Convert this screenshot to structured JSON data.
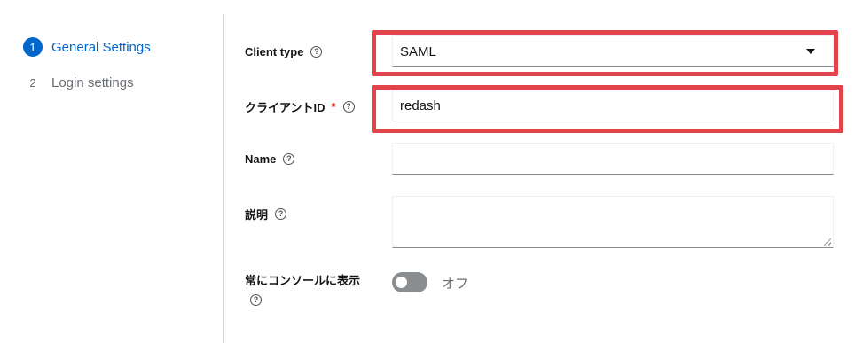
{
  "wizard": {
    "steps": [
      {
        "number": "1",
        "label": "General Settings"
      },
      {
        "number": "2",
        "label": "Login settings"
      }
    ]
  },
  "form": {
    "client_type": {
      "label": "Client type",
      "value": "SAML"
    },
    "client_id": {
      "label": "クライアントID",
      "required_mark": "*",
      "value": "redash"
    },
    "name": {
      "label": "Name",
      "value": ""
    },
    "description": {
      "label": "説明",
      "value": ""
    },
    "always_display": {
      "label": "常にコンソールに表示",
      "toggle_text": "オフ",
      "checked": false
    },
    "help_glyph": "?"
  },
  "colors": {
    "accent": "#0066cc",
    "highlight": "#e3434b",
    "required": "#c9190b"
  }
}
